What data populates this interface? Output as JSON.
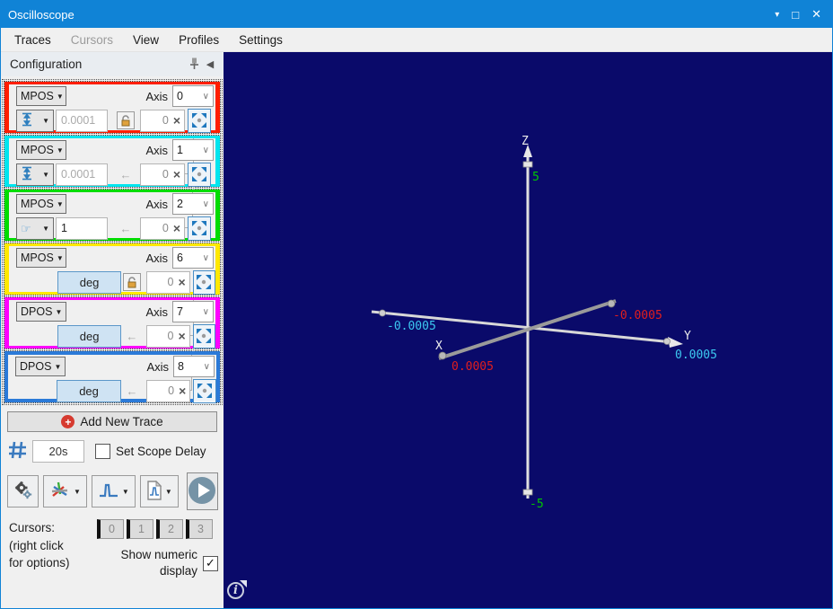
{
  "window": {
    "title": "Oscilloscope"
  },
  "icons": {
    "dropdown": "▼",
    "chevron": "∨",
    "menu_down": "▾",
    "maximize": "□",
    "close": "✕",
    "collapse_left": "◀",
    "clear": "×",
    "check": "✓",
    "plus": "+",
    "left_arrow": "←",
    "info": "i"
  },
  "menu": {
    "items": [
      {
        "label": "Traces",
        "enabled": true
      },
      {
        "label": "Cursors",
        "enabled": false
      },
      {
        "label": "View",
        "enabled": true
      },
      {
        "label": "Profiles",
        "enabled": true
      },
      {
        "label": "Settings",
        "enabled": true
      }
    ]
  },
  "panel": {
    "title": "Configuration"
  },
  "labels": {
    "axis": "Axis"
  },
  "traces": [
    {
      "type": "MPOS",
      "axis": "0",
      "scale": "0.0001",
      "offset": "0",
      "color": "#ff1e00",
      "scale_icon": "autoscale",
      "has_lock": true
    },
    {
      "type": "MPOS",
      "axis": "1",
      "scale": "0.0001",
      "offset": "0",
      "color": "#00e5ee",
      "scale_icon": "autoscale",
      "has_lock": false
    },
    {
      "type": "MPOS",
      "axis": "2",
      "scale": "1",
      "offset": "0",
      "color": "#00dc00",
      "scale_icon": "manual",
      "has_lock": false
    },
    {
      "type": "MPOS",
      "axis": "6",
      "unit": "deg",
      "offset": "0",
      "color": "#ffe800",
      "has_lock": true
    },
    {
      "type": "DPOS",
      "axis": "7",
      "unit": "deg",
      "offset": "0",
      "color": "#ff00ff",
      "has_lock": false
    },
    {
      "type": "DPOS",
      "axis": "8",
      "unit": "deg",
      "offset": "0",
      "color": "#2b7ad8",
      "has_lock": false
    }
  ],
  "controls": {
    "add_trace": "Add New Trace",
    "scope_delay_value": "20s",
    "scope_delay_label": "Set Scope Delay",
    "scope_delay_checked": false
  },
  "cursors": {
    "heading": "Cursors:",
    "hint_line1": "(right click",
    "hint_line2": "for options)",
    "buttons": [
      "0",
      "1",
      "2",
      "3"
    ],
    "numeric_line1": "Show numeric",
    "numeric_line2": "display",
    "numeric_checked": true
  },
  "plot": {
    "background": "#0a0a6a",
    "axes": {
      "z": {
        "label": "Z",
        "max": "5",
        "min": "-5",
        "value_color": "#00c800"
      },
      "y": {
        "label": "Y",
        "max": "0.0005",
        "min": "-0.0005",
        "value_color": "#3cc8f0"
      },
      "x": {
        "label": "X",
        "max": "0.0005",
        "min": "-0.0005",
        "value_color": "#e01e1e"
      }
    }
  }
}
